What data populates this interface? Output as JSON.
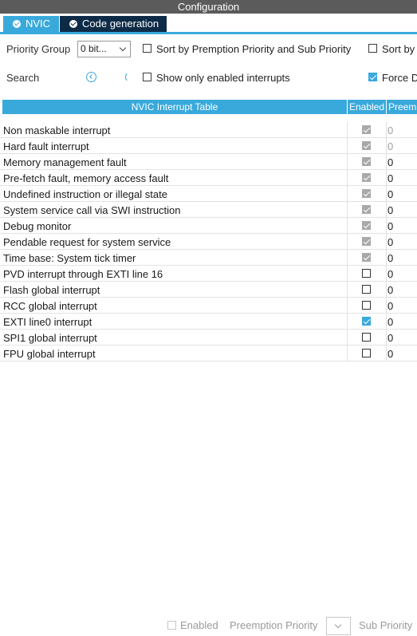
{
  "window": {
    "title": "Configuration"
  },
  "tabs": [
    {
      "label": "NVIC",
      "active": true,
      "icon": "check-circle-icon"
    },
    {
      "label": "Code generation",
      "active": false,
      "icon": "check-circle-icon"
    }
  ],
  "controls": {
    "priority_group_label": "Priority Group",
    "priority_group_value": "0 bit...",
    "sort_premption_label": "Sort by Premption Priority and Sub Priority",
    "sort_premption_checked": false,
    "sort_by_label": "Sort by",
    "sort_by_checked": false,
    "search_label": "Search",
    "show_only_enabled_label": "Show only enabled interrupts",
    "show_only_enabled_checked": false,
    "force_label": "Force D",
    "force_checked": true
  },
  "table": {
    "headers": [
      "NVIC Interrupt Table",
      "Enabled",
      "Preem"
    ],
    "rows": [
      {
        "name": "Non maskable interrupt",
        "enabled": true,
        "locked": true,
        "priority": "0",
        "priority_dim": true
      },
      {
        "name": "Hard fault interrupt",
        "enabled": true,
        "locked": true,
        "priority": "0",
        "priority_dim": true
      },
      {
        "name": "Memory management fault",
        "enabled": true,
        "locked": true,
        "priority": "0",
        "priority_dim": false
      },
      {
        "name": "Pre-fetch fault, memory access fault",
        "enabled": true,
        "locked": true,
        "priority": "0",
        "priority_dim": false
      },
      {
        "name": "Undefined instruction or illegal state",
        "enabled": true,
        "locked": true,
        "priority": "0",
        "priority_dim": false
      },
      {
        "name": "System service call via SWI instruction",
        "enabled": true,
        "locked": true,
        "priority": "0",
        "priority_dim": false
      },
      {
        "name": "Debug monitor",
        "enabled": true,
        "locked": true,
        "priority": "0",
        "priority_dim": false
      },
      {
        "name": "Pendable request for system service",
        "enabled": true,
        "locked": true,
        "priority": "0",
        "priority_dim": false
      },
      {
        "name": "Time base: System tick timer",
        "enabled": true,
        "locked": true,
        "priority": "0",
        "priority_dim": false
      },
      {
        "name": "PVD interrupt through EXTI line 16",
        "enabled": false,
        "locked": false,
        "priority": "0",
        "priority_dim": false
      },
      {
        "name": "Flash global interrupt",
        "enabled": false,
        "locked": false,
        "priority": "0",
        "priority_dim": false
      },
      {
        "name": "RCC global interrupt",
        "enabled": false,
        "locked": false,
        "priority": "0",
        "priority_dim": false
      },
      {
        "name": "EXTI line0 interrupt",
        "enabled": true,
        "locked": false,
        "priority": "0",
        "priority_dim": false
      },
      {
        "name": "SPI1 global interrupt",
        "enabled": false,
        "locked": false,
        "priority": "0",
        "priority_dim": false
      },
      {
        "name": "FPU global interrupt",
        "enabled": false,
        "locked": false,
        "priority": "0",
        "priority_dim": false
      }
    ]
  },
  "footer": {
    "enabled_label": "Enabled",
    "preemption_label": "Preemption Priority",
    "sub_priority_label": "Sub Priority"
  },
  "colors": {
    "accent": "#39a9dc",
    "titlebar": "#5b5b5b",
    "tab_inactive": "#0d2b47"
  }
}
